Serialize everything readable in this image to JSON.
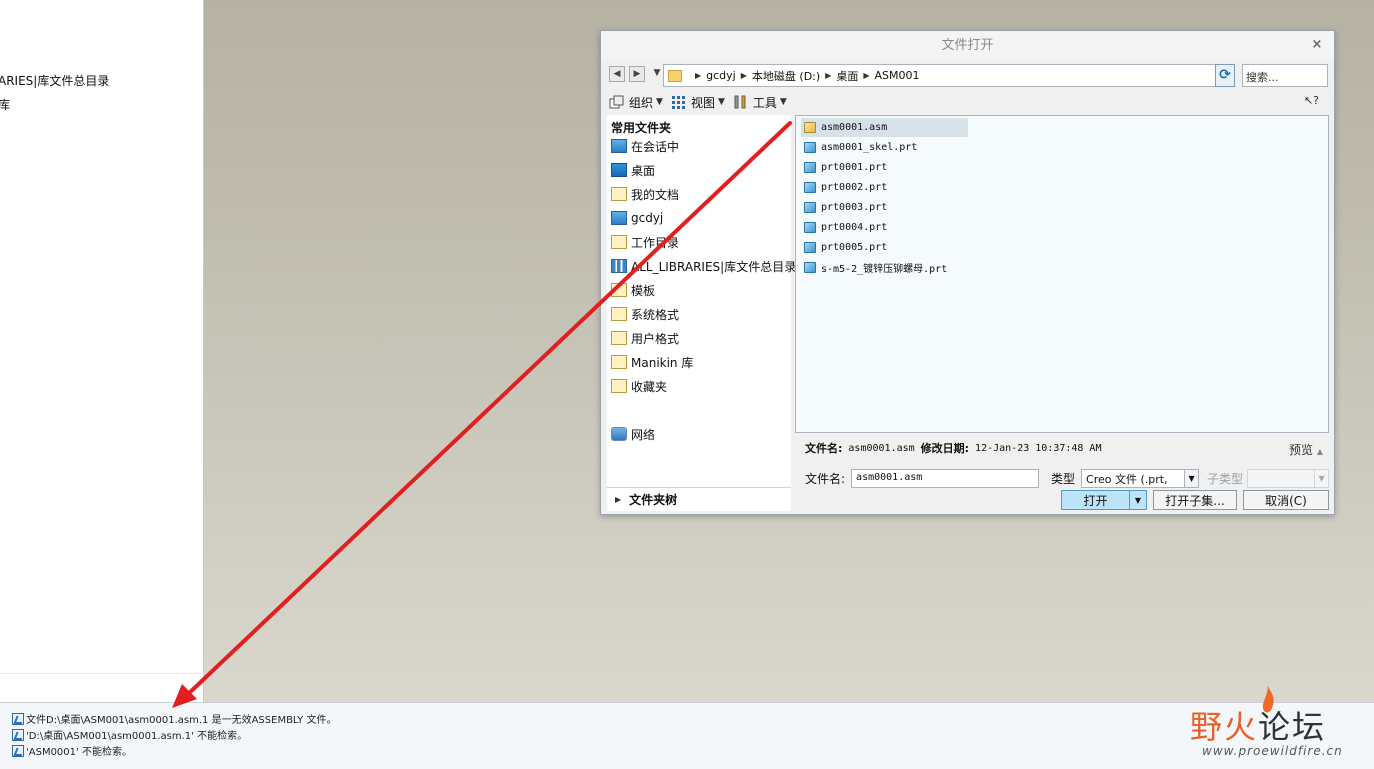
{
  "left_panel": {
    "items": [
      "ARIES|库文件总目录",
      "库"
    ]
  },
  "messages": [
    "文件D:\\桌面\\ASM001\\asm0001.asm.1 是一无效ASSEMBLY 文件。",
    "'D:\\桌面\\ASM001\\asm0001.asm.1' 不能检索。",
    "'ASM0001' 不能检索。"
  ],
  "dialog": {
    "title": "文件打开",
    "close": "×",
    "breadcrumb": [
      "gcdyj",
      "本地磁盘 (D:)",
      "桌面",
      "ASM001"
    ],
    "search_placeholder": "搜索...",
    "toolbar": {
      "organize": "组织",
      "view": "视图",
      "tools": "工具",
      "help": "?"
    },
    "favorites_title": "常用文件夹",
    "favorites": [
      {
        "label": "在会话中",
        "icon": "monitor"
      },
      {
        "label": "桌面",
        "icon": "desk"
      },
      {
        "label": "我的文档",
        "icon": "folder"
      },
      {
        "label": "gcdyj",
        "icon": "monitor"
      },
      {
        "label": "工作目录",
        "icon": "folder"
      },
      {
        "label": "ALL_LIBRARIES|库文件总目录",
        "icon": "chart"
      },
      {
        "label": "模板",
        "icon": "folder"
      },
      {
        "label": "系统格式",
        "icon": "folder"
      },
      {
        "label": "用户格式",
        "icon": "folder"
      },
      {
        "label": "Manikin 库",
        "icon": "folder"
      },
      {
        "label": "收藏夹",
        "icon": "folder"
      }
    ],
    "network": "网络",
    "folder_tree": "文件夹树",
    "files": [
      {
        "name": "asm0001.asm",
        "type": "asm"
      },
      {
        "name": "asm0001_skel.prt",
        "type": "prt"
      },
      {
        "name": "prt0001.prt",
        "type": "prt"
      },
      {
        "name": "prt0002.prt",
        "type": "prt"
      },
      {
        "name": "prt0003.prt",
        "type": "prt"
      },
      {
        "name": "prt0004.prt",
        "type": "prt"
      },
      {
        "name": "prt0005.prt",
        "type": "prt"
      },
      {
        "name": "s-m5-2_镀锌压铆螺母.prt",
        "type": "prt"
      }
    ],
    "selected_file": "asm0001.asm",
    "info": {
      "file_label": "文件名:",
      "file_value": "asm0001.asm",
      "date_label": "修改日期:",
      "date_value": "12-Jan-23 10:37:48 AM",
      "preview": "预览"
    },
    "name_row": {
      "label": "文件名:",
      "value": "asm0001.asm",
      "type_label": "类型",
      "type_value": "Creo 文件 (.prt,",
      "subtype_label": "子类型"
    },
    "buttons": {
      "open": "打开",
      "open_subset": "打开子集...",
      "cancel": "取消(C)"
    }
  },
  "watermark": {
    "part1": "野火",
    "part2": "论坛",
    "url": "www.proewildfire.cn"
  },
  "colors": {
    "arrow": "#e02020",
    "accent": "#bde3f8"
  }
}
